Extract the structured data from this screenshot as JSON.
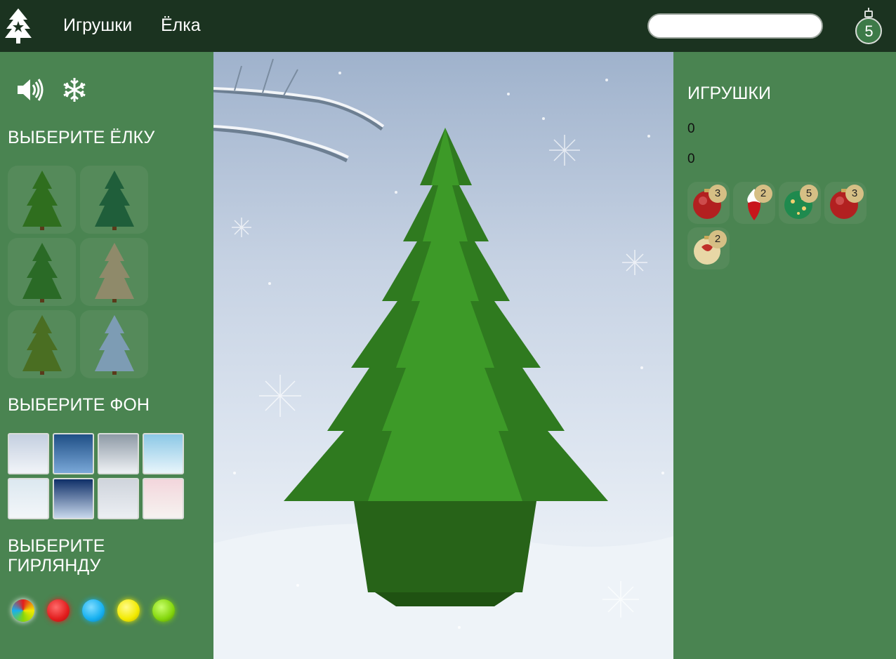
{
  "header": {
    "logo_icon": "christmas-tree-star-icon",
    "nav": [
      {
        "label": "Игрушки"
      },
      {
        "label": "Ёлка"
      }
    ],
    "search": {
      "value": "",
      "placeholder": ""
    },
    "selected_count": "5",
    "counter_icon": "ornament-icon"
  },
  "left": {
    "controls": [
      {
        "icon": "speaker-icon"
      },
      {
        "icon": "snowflake-icon"
      }
    ],
    "tree_title": "ВЫБЕРИТЕ ЁЛКУ",
    "trees": [
      {
        "icon": "tree-1-icon",
        "color": "#2f6e1e"
      },
      {
        "icon": "tree-2-icon",
        "color": "#1f5e3a"
      },
      {
        "icon": "tree-3-icon",
        "color": "#2a6a26"
      },
      {
        "icon": "tree-4-icon",
        "color": "#8f8a6a"
      },
      {
        "icon": "tree-5-icon",
        "color": "#4a6e22"
      },
      {
        "icon": "tree-6-icon",
        "color": "#7d9cb4"
      }
    ],
    "bg_title": "ВЫБЕРИТЕ ФОН",
    "backgrounds": [
      {
        "name": "bg-1",
        "top": "#c4cfe0",
        "bottom": "#f1f4f8"
      },
      {
        "name": "bg-2",
        "top": "#1f4f86",
        "bottom": "#7aa8d8"
      },
      {
        "name": "bg-3",
        "top": "#8e9aa6",
        "bottom": "#eef1f4"
      },
      {
        "name": "bg-4",
        "top": "#8cc8e6",
        "bottom": "#e8f5fb"
      },
      {
        "name": "bg-5",
        "top": "#dce8f0",
        "bottom": "#f3f6f9"
      },
      {
        "name": "bg-6",
        "top": "#0f2f68",
        "bottom": "#c8d8ec"
      },
      {
        "name": "bg-7",
        "top": "#cfd4dc",
        "bottom": "#eceff3"
      },
      {
        "name": "bg-8",
        "top": "#f3d6dc",
        "bottom": "#f6f3f0"
      }
    ],
    "garland_title": "ВЫБЕРИТЕ ГИРЛЯНДУ",
    "garlands": [
      {
        "name": "multicolor",
        "color": "multi"
      },
      {
        "name": "red",
        "color": "#e21d1d"
      },
      {
        "name": "blue",
        "color": "#16b0f0"
      },
      {
        "name": "yellow",
        "color": "#f2ea00"
      },
      {
        "name": "green",
        "color": "#84d60c"
      }
    ]
  },
  "right": {
    "title": "ИГРУШКИ",
    "value_1": "0",
    "value_2": "0",
    "toys": [
      {
        "count": "3",
        "icon": "red-ball-icon",
        "color": "#b22020"
      },
      {
        "count": "2",
        "icon": "white-red-drop-icon",
        "color": "#c8151b"
      },
      {
        "count": "5",
        "icon": "green-ball-icon",
        "color": "#1f8a4e"
      },
      {
        "count": "3",
        "icon": "red-ball-icon",
        "color": "#b22020"
      },
      {
        "count": "2",
        "icon": "gold-ball-icon",
        "color": "#e8d7a6"
      }
    ]
  }
}
